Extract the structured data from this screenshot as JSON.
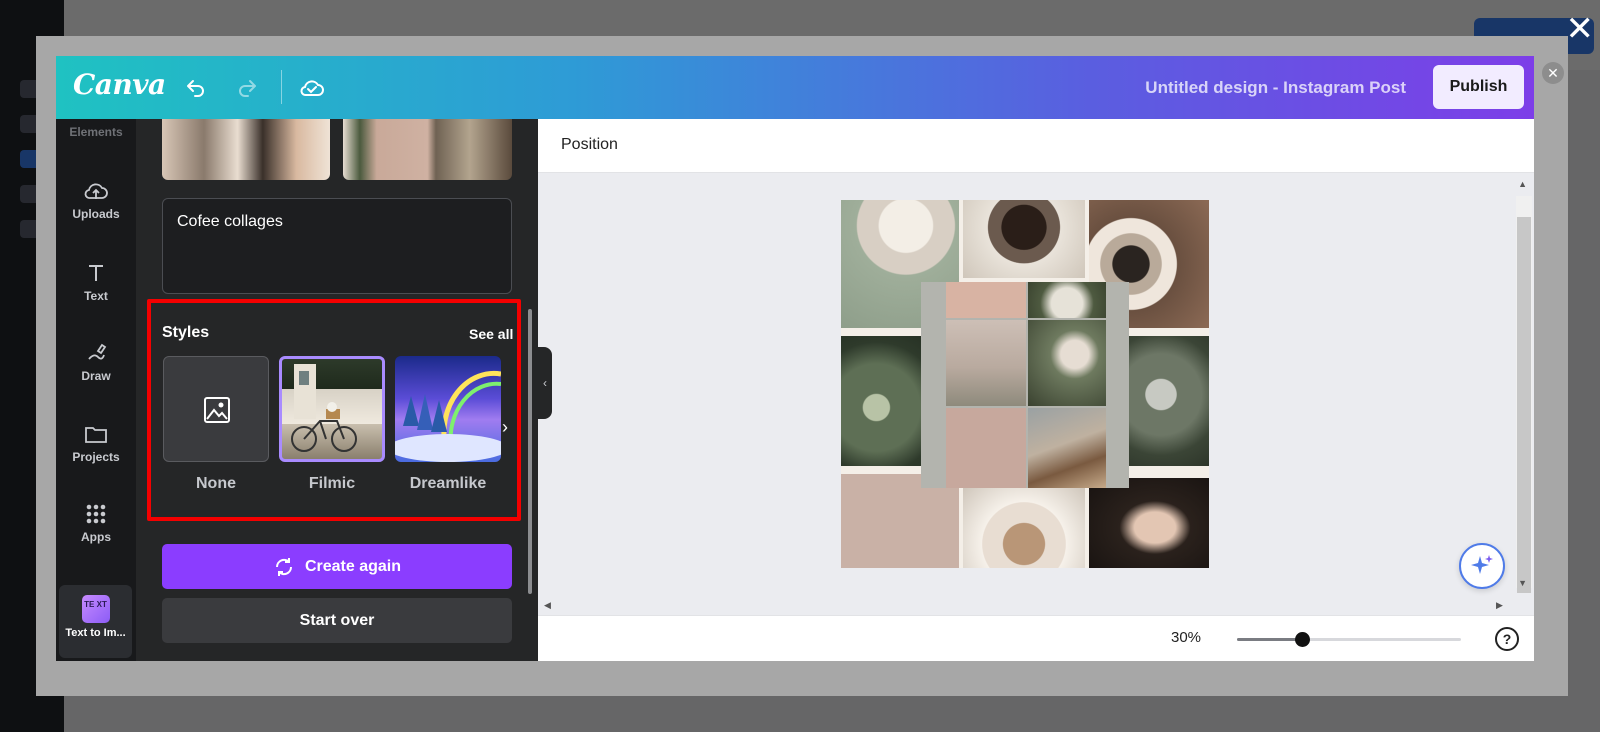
{
  "window": {
    "close_glyph": "×"
  },
  "header": {
    "logo": "Canva",
    "doc_title": "Untitled design - Instagram Post",
    "publish_label": "Publish",
    "icons": [
      "undo-icon",
      "redo-icon",
      "cloud-saved-icon"
    ]
  },
  "rail": {
    "items": [
      {
        "label": "Elements",
        "icon": "elements-icon"
      },
      {
        "label": "Uploads",
        "icon": "cloud-upload-icon"
      },
      {
        "label": "Text",
        "icon": "text-icon"
      },
      {
        "label": "Draw",
        "icon": "draw-icon"
      },
      {
        "label": "Projects",
        "icon": "folder-icon"
      },
      {
        "label": "Apps",
        "icon": "apps-grid-icon"
      }
    ],
    "active": {
      "label": "Text to Im...",
      "icon": "text-to-image-icon",
      "icon_text": "TE XT"
    }
  },
  "panel": {
    "prompt": "Cofee collages",
    "styles": {
      "title": "Styles",
      "see_all": "See all",
      "options": [
        {
          "label": "None",
          "icon": "image-icon",
          "selected": false
        },
        {
          "label": "Filmic",
          "selected": true
        },
        {
          "label": "Dreamlike",
          "selected": false
        }
      ]
    },
    "create_again": "Create again",
    "start_over": "Start over"
  },
  "editor": {
    "toolbar_label": "Position",
    "zoom": "30%",
    "zoom_fraction": 0.29,
    "help": "?"
  },
  "colors": {
    "accent_purple": "#8b3dff",
    "highlight_red": "#f40000",
    "header_gradient_start": "#1fc2c2",
    "header_gradient_end": "#7d3ee8"
  }
}
